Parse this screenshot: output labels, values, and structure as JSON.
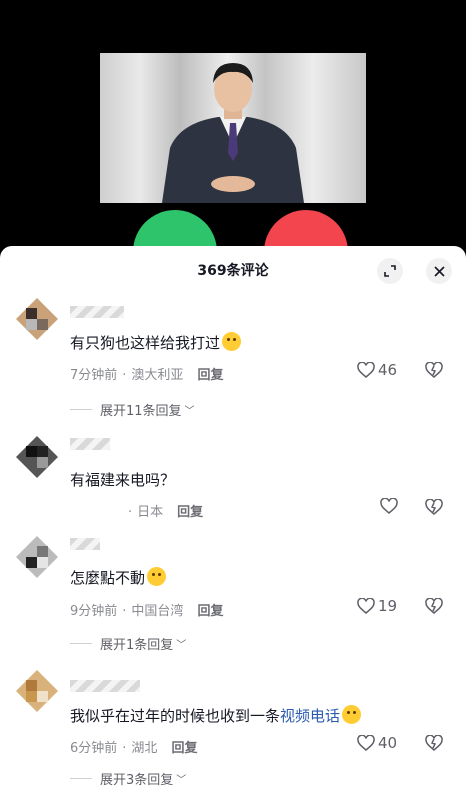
{
  "sheet": {
    "title": "369条评论"
  },
  "comments": [
    {
      "text": "有只狗也这样给我打过",
      "time": "7分钟前",
      "location": "澳大利亚",
      "reply_label": "回复",
      "likes": "46",
      "expand_label": "展开11条回复"
    },
    {
      "text": "有福建来电吗？",
      "time": "",
      "location": "日本",
      "reply_label": "回复",
      "likes": ""
    },
    {
      "text": "怎麼點不動",
      "time": "9分钟前",
      "location": "中国台湾",
      "reply_label": "回复",
      "likes": "19",
      "expand_label": "展开1条回复"
    },
    {
      "text_before": "我似乎在过年的时候也收到一条",
      "text_highlight": "视频电话",
      "time": "6分钟前",
      "location": "湖北",
      "reply_label": "回复",
      "likes": "40",
      "expand_label": "展开3条回复"
    }
  ]
}
